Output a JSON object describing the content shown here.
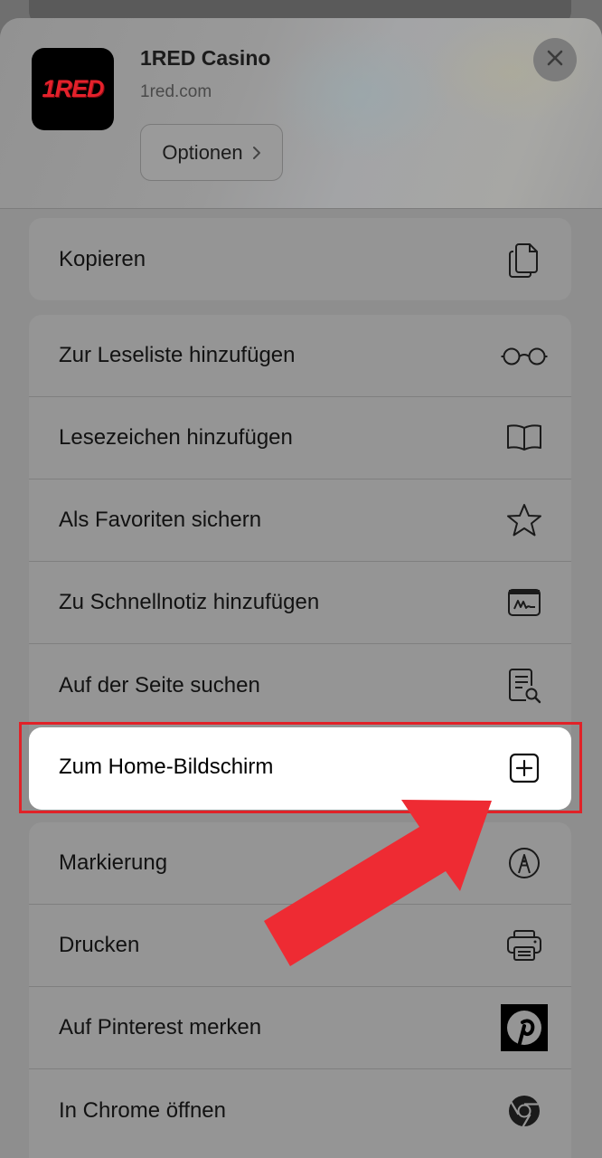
{
  "app": {
    "icon_text": "1RED",
    "title": "1RED Casino",
    "domain": "1red.com",
    "options_label": "Optionen"
  },
  "groups": [
    {
      "items": [
        {
          "label": "Kopieren",
          "icon": "copy-icon"
        }
      ]
    },
    {
      "items": [
        {
          "label": "Zur Leseliste hinzufügen",
          "icon": "glasses-icon"
        },
        {
          "label": "Lesezeichen hinzufügen",
          "icon": "book-icon"
        },
        {
          "label": "Als Favoriten sichern",
          "icon": "star-icon"
        },
        {
          "label": "Zu Schnellnotiz hinzufügen",
          "icon": "quick-note-icon"
        },
        {
          "label": "Auf der Seite suchen",
          "icon": "find-on-page-icon"
        },
        {
          "label": "Zum Home-Bildschirm",
          "icon": "add-square-icon",
          "highlighted": true
        }
      ]
    },
    {
      "items": [
        {
          "label": "Markierung",
          "icon": "markup-pen-icon"
        },
        {
          "label": "Drucken",
          "icon": "printer-icon"
        },
        {
          "label": "Auf Pinterest merken",
          "icon": "pinterest-icon"
        },
        {
          "label": "In Chrome öffnen",
          "icon": "chrome-icon"
        }
      ]
    }
  ],
  "colors": {
    "highlight_border": "#e12228",
    "arrow": "#ee2b33",
    "overlay": "#8e8e8e"
  }
}
